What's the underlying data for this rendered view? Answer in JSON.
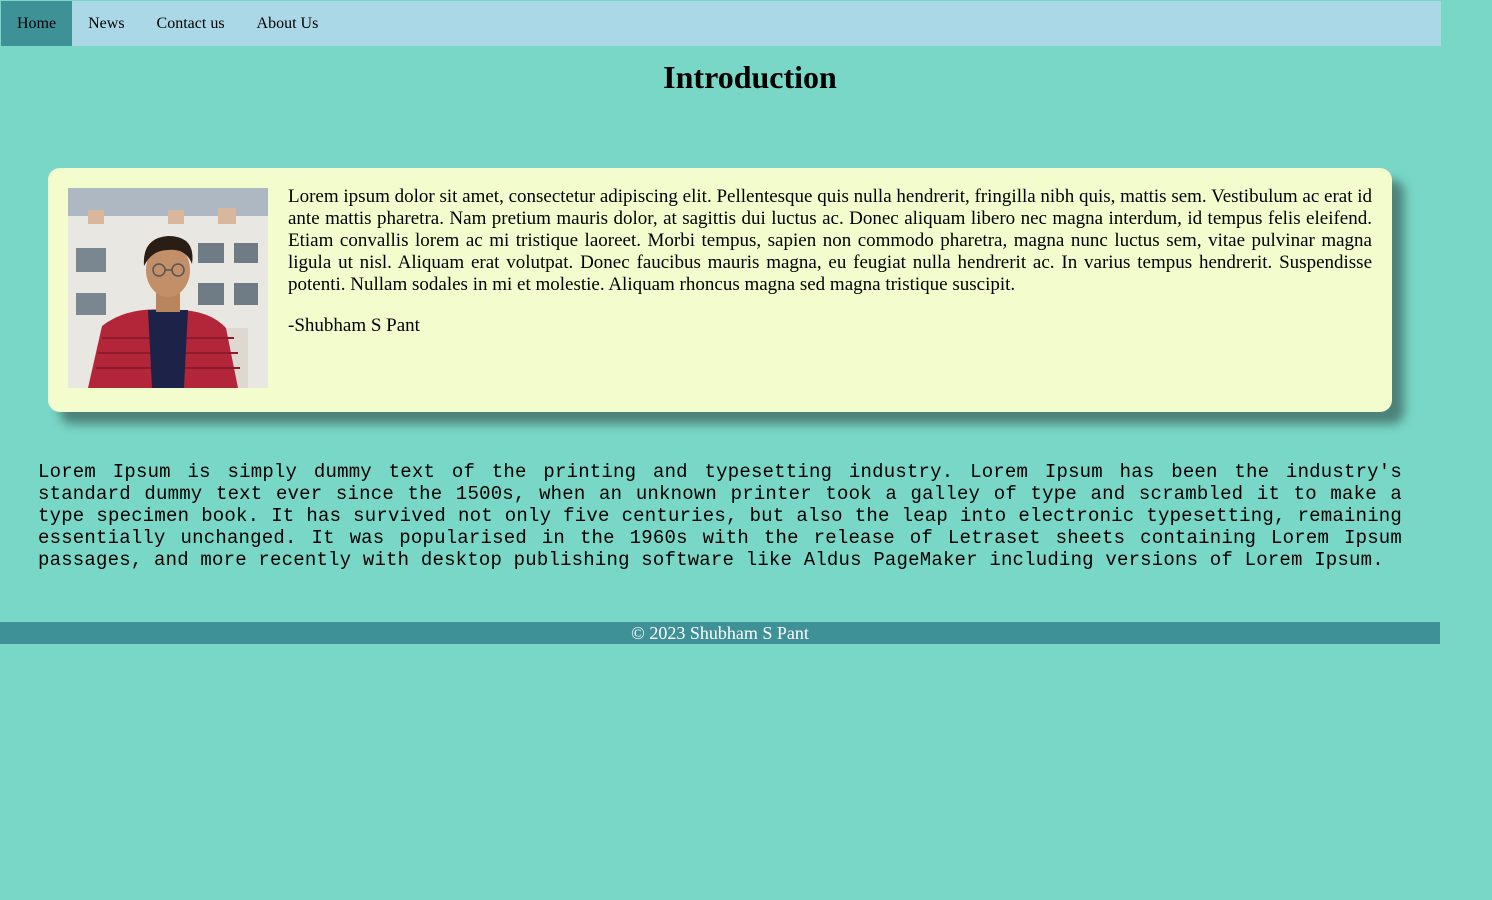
{
  "nav": {
    "items": [
      {
        "label": "Home",
        "active": true
      },
      {
        "label": "News",
        "active": false
      },
      {
        "label": "Contact us",
        "active": false
      },
      {
        "label": "About Us",
        "active": false
      }
    ]
  },
  "main": {
    "title": "Introduction"
  },
  "card": {
    "photo_icon": "portrait-photo",
    "text": "Lorem ipsum dolor sit amet, consectetur adipiscing elit. Pellentesque quis nulla hendrerit, fringilla nibh quis, mattis sem. Vestibulum ac erat id ante mattis pharetra. Nam pretium mauris dolor, at sagittis dui luctus ac. Donec aliquam libero nec magna interdum, id tempus felis eleifend. Etiam convallis lorem ac mi tristique laoreet. Morbi tempus, sapien non commodo pharetra, magna nunc luctus sem, vitae pulvinar magna ligula ut nisl. Aliquam erat volutpat. Donec faucibus mauris magna, eu feugiat nulla hendrerit ac. In varius tempus hendrerit. Suspendisse potenti. Nullam sodales in mi et molestie. Aliquam rhoncus magna sed magna tristique suscipit.",
    "author": "-Shubham S Pant"
  },
  "mono_text": "Lorem Ipsum is simply dummy text of the printing and typesetting industry. Lorem Ipsum has been the industry's standard dummy text ever since the 1500s, when an unknown printer took a galley of type and scrambled it to make a type specimen book. It has survived not only five centuries, but also the leap into electronic typesetting, remaining essentially unchanged. It was popularised in the 1960s with the release of Letraset sheets containing Lorem Ipsum passages, and more recently with desktop publishing software like Aldus PageMaker including versions of Lorem Ipsum.",
  "footer": {
    "text": "© 2023 Shubham S Pant"
  },
  "colors": {
    "background": "#78d7c6",
    "navbar": "#aad8e6",
    "active_nav": "#3f9198",
    "card": "#f3fccc",
    "footer": "#3f9198"
  }
}
